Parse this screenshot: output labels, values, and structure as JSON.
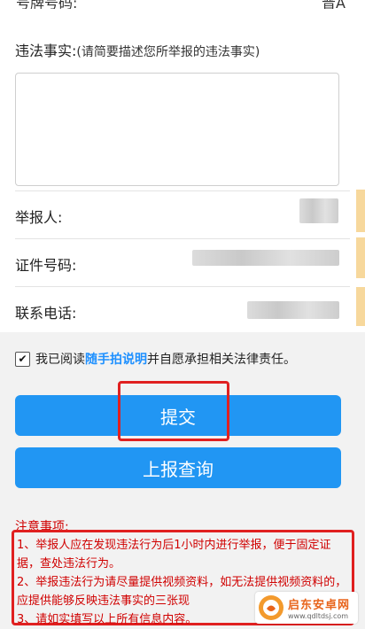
{
  "top_row": {
    "label": "号牌号码:",
    "value": "晋A"
  },
  "description": {
    "label": "违法事实:",
    "hint": "(请简要描述您所举报的违法事实)",
    "value": ""
  },
  "fields": [
    {
      "label": "举报人:"
    },
    {
      "label": "证件号码:"
    },
    {
      "label": "联系电话:"
    }
  ],
  "agreement": {
    "checked": true,
    "check_glyph": "✔",
    "prefix": "我已阅读",
    "link": "随手拍说明",
    "suffix": "并自愿承担相关法律责任。"
  },
  "buttons": {
    "submit": "提交",
    "query": "上报查询"
  },
  "notes": {
    "title": "注意事项:",
    "items": [
      "1、举报人应在发现违法行为后1小时内进行举报，便于固定证据，查处违法行为。",
      "2、举报违法行为请尽量提供视频资料，如无法提供视频资料的，应提供能够反映违法事实的三张现",
      "3、请如实填写以上所有信息内容。"
    ]
  },
  "watermark": {
    "name": "启东安卓网",
    "url": "www.qdltdsj.com"
  },
  "colors": {
    "primary": "#2196f3",
    "warning": "#d00000",
    "highlight": "#e02020"
  }
}
